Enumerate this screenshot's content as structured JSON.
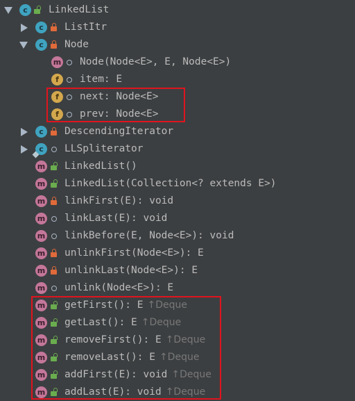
{
  "tree": {
    "root": {
      "label": "LinkedList",
      "icon": "class-icon",
      "visibility": "public"
    },
    "list_itr": {
      "label": "ListItr",
      "icon": "class-icon",
      "visibility": "private"
    },
    "node": {
      "label": "Node",
      "icon": "class-icon",
      "visibility": "private",
      "children": [
        {
          "label": "Node(Node<E>, E, Node<E>)",
          "icon": "method-icon",
          "visibility": "package"
        },
        {
          "label": "item: E",
          "icon": "field-icon",
          "visibility": "package"
        },
        {
          "label": "next: Node<E>",
          "icon": "field-icon",
          "visibility": "package"
        },
        {
          "label": "prev: Node<E>",
          "icon": "field-icon",
          "visibility": "package"
        }
      ]
    },
    "descending_iterator": {
      "label": "DescendingIterator",
      "icon": "class-icon",
      "visibility": "private"
    },
    "ll_spliterator": {
      "label": "LLSpliterator",
      "icon": "class-icon",
      "visibility": "package"
    },
    "members": [
      {
        "label": "LinkedList()",
        "visibility": "public"
      },
      {
        "label": "LinkedList(Collection<? extends E>)",
        "visibility": "public"
      },
      {
        "label": "linkFirst(E): void",
        "visibility": "private"
      },
      {
        "label": "linkLast(E): void",
        "visibility": "package"
      },
      {
        "label": "linkBefore(E, Node<E>): void",
        "visibility": "package"
      },
      {
        "label": "unlinkFirst(Node<E>): E",
        "visibility": "private"
      },
      {
        "label": "unlinkLast(Node<E>): E",
        "visibility": "private"
      },
      {
        "label": "unlink(Node<E>): E",
        "visibility": "package"
      },
      {
        "label": "getFirst(): E",
        "visibility": "public",
        "inherited": "↑Deque"
      },
      {
        "label": "getLast(): E",
        "visibility": "public",
        "inherited": "↑Deque"
      },
      {
        "label": "removeFirst(): E",
        "visibility": "public",
        "inherited": "↑Deque"
      },
      {
        "label": "removeLast(): E",
        "visibility": "public",
        "inherited": "↑Deque"
      },
      {
        "label": "addFirst(E): void",
        "visibility": "public",
        "inherited": "↑Deque"
      },
      {
        "label": "addLast(E): void",
        "visibility": "public",
        "inherited": "↑Deque"
      }
    ]
  },
  "icon_letters": {
    "class": "c",
    "method": "m",
    "field": "f"
  },
  "colors": {
    "background": "#3c3f41",
    "text": "#bbbbbb",
    "inherited_text": "#787878",
    "class_icon": "#3fa3c0",
    "method_icon": "#c4779a",
    "field_icon": "#d3a84d",
    "private_lock": "#e06a3a",
    "public_lock": "#6aad4f",
    "highlight_box": "#e0141e"
  }
}
